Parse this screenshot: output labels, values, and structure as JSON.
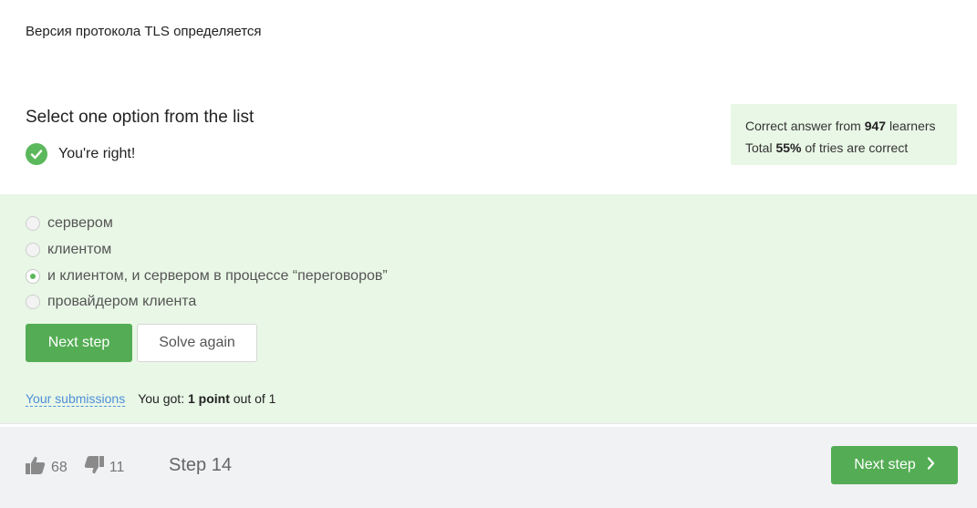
{
  "question": {
    "text": "Версия протокола TLS определяется"
  },
  "quiz": {
    "title": "Select one option from the list",
    "result_text": "You're right!",
    "options": [
      {
        "label": "сервером",
        "selected": false
      },
      {
        "label": "клиентом",
        "selected": false
      },
      {
        "label": "и клиентом, и сервером в процессе “переговоров”",
        "selected": true
      },
      {
        "label": "провайдером клиента",
        "selected": false
      }
    ],
    "next_label": "Next step",
    "solve_again_label": "Solve again",
    "submissions_link": "Your submissions",
    "score_prefix": "You got:",
    "score_value": "1 point",
    "score_suffix": "out of 1"
  },
  "stats": {
    "line1_prefix": "Correct answer from",
    "learners_count": "947",
    "line1_suffix": "learners",
    "line2_prefix": "Total",
    "percent": "55%",
    "line2_suffix": "of tries are correct"
  },
  "footer": {
    "likes": "68",
    "dislikes": "11",
    "step_label": "Step 14",
    "next_label": "Next step"
  },
  "colors": {
    "accent_green": "#54ad54",
    "success_bg": "#e9f7e6",
    "link_blue": "#4d8fd8",
    "footer_bg": "#f1f2f4"
  }
}
